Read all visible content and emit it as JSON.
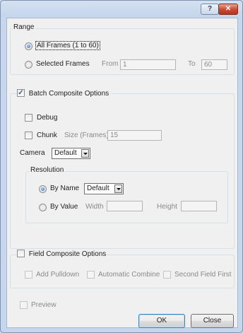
{
  "titlebar": {
    "help_glyph": "?",
    "close_glyph": "✕"
  },
  "range": {
    "title": "Range",
    "all_frames": "All Frames (1 to 60)",
    "selected_frames": "Selected Frames",
    "from_label": "From",
    "from_value": "1",
    "to_label": "To",
    "to_value": "60",
    "selected_option": "all_frames"
  },
  "batch": {
    "title": "Batch Composite Options",
    "checked": true,
    "debug_label": "Debug",
    "chunk_label": "Chunk",
    "size_label": "Size (Frames)",
    "size_value": "15",
    "camera_label": "Camera",
    "camera_value": "Default",
    "resolution": {
      "title": "Resolution",
      "by_name": "By Name",
      "by_name_value": "Default",
      "by_value": "By Value",
      "width_label": "Width",
      "height_label": "Height",
      "selected_option": "by_name"
    }
  },
  "field": {
    "title": "Field Composite Options",
    "add_pulldown": "Add Pulldown",
    "automatic_combine": "Automatic Combine",
    "second_field_first": "Second Field First"
  },
  "preview_label": "Preview",
  "buttons": {
    "ok": "OK",
    "close": "Close"
  },
  "colors": {
    "accent": "#1d5fb0",
    "close_button": "#c9482f",
    "client_bg": "#f0f0f0"
  }
}
